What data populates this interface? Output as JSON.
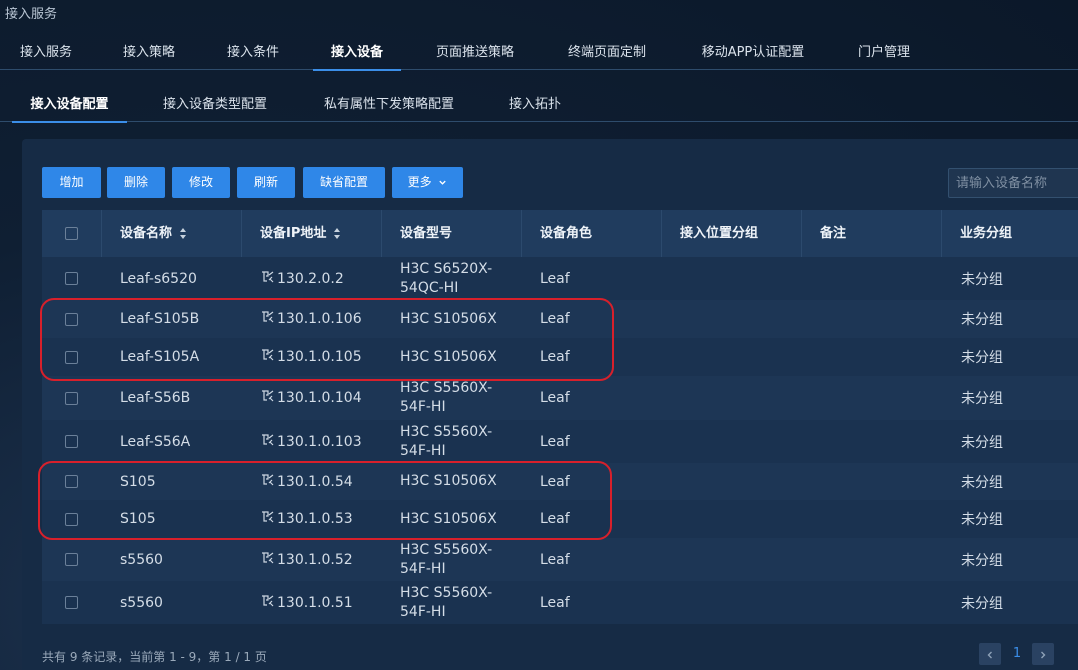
{
  "window": {
    "title": "接入服务"
  },
  "main_tabs": [
    {
      "label": "接入服务"
    },
    {
      "label": "接入策略"
    },
    {
      "label": "接入条件"
    },
    {
      "label": "接入设备"
    },
    {
      "label": "页面推送策略"
    },
    {
      "label": "终端页面定制"
    },
    {
      "label": "移动APP认证配置"
    },
    {
      "label": "门户管理"
    }
  ],
  "active_main_tab": "接入设备",
  "sub_tabs": [
    {
      "label": "接入设备配置"
    },
    {
      "label": "接入设备类型配置"
    },
    {
      "label": "私有属性下发策略配置"
    },
    {
      "label": "接入拓扑"
    }
  ],
  "active_sub_tab": "接入设备配置",
  "toolbar": {
    "add": "增加",
    "delete": "删除",
    "modify": "修改",
    "refresh": "刷新",
    "default_config": "缺省配置",
    "more": "更多"
  },
  "search": {
    "placeholder": "请输入设备名称"
  },
  "table": {
    "columns": [
      "设备名称",
      "设备IP地址",
      "设备型号",
      "设备角色",
      "接入位置分组",
      "备注",
      "业务分组"
    ],
    "rows": [
      {
        "name": "Leaf-s6520",
        "ip": "130.2.0.2",
        "model": "H3C S6520X-54QC-HI",
        "role": "Leaf",
        "location": "",
        "remark": "",
        "group": "未分组"
      },
      {
        "name": "Leaf-S105B",
        "ip": "130.1.0.106",
        "model": "H3C S10506X",
        "role": "Leaf",
        "location": "",
        "remark": "",
        "group": "未分组"
      },
      {
        "name": "Leaf-S105A",
        "ip": "130.1.0.105",
        "model": "H3C S10506X",
        "role": "Leaf",
        "location": "",
        "remark": "",
        "group": "未分组"
      },
      {
        "name": "Leaf-S56B",
        "ip": "130.1.0.104",
        "model": "H3C S5560X-54F-HI",
        "role": "Leaf",
        "location": "",
        "remark": "",
        "group": "未分组"
      },
      {
        "name": "Leaf-S56A",
        "ip": "130.1.0.103",
        "model": "H3C S5560X-54F-HI",
        "role": "Leaf",
        "location": "",
        "remark": "",
        "group": "未分组"
      },
      {
        "name": "S105",
        "ip": "130.1.0.54",
        "model": "H3C S10506X",
        "role": "Leaf",
        "location": "",
        "remark": "",
        "group": "未分组"
      },
      {
        "name": "S105",
        "ip": "130.1.0.53",
        "model": "H3C S10506X",
        "role": "Leaf",
        "location": "",
        "remark": "",
        "group": "未分组"
      },
      {
        "name": "s5560",
        "ip": "130.1.0.52",
        "model": "H3C S5560X-54F-HI",
        "role": "Leaf",
        "location": "",
        "remark": "",
        "group": "未分组"
      },
      {
        "name": "s5560",
        "ip": "130.1.0.51",
        "model": "H3C S5560X-54F-HI",
        "role": "Leaf",
        "location": "",
        "remark": "",
        "group": "未分组"
      }
    ]
  },
  "footer": {
    "summary": "共有 9 条记录，当前第 1 - 9，第 1 / 1 页",
    "current_page": "1"
  },
  "colors": {
    "accent": "#2f87e8",
    "highlight": "#d8202b"
  },
  "icons": {
    "sort": "sort-icon",
    "device_link": "device-link-icon",
    "chevron": "chevron-down-icon",
    "prev": "chevron-left-icon",
    "next": "chevron-right-icon"
  }
}
